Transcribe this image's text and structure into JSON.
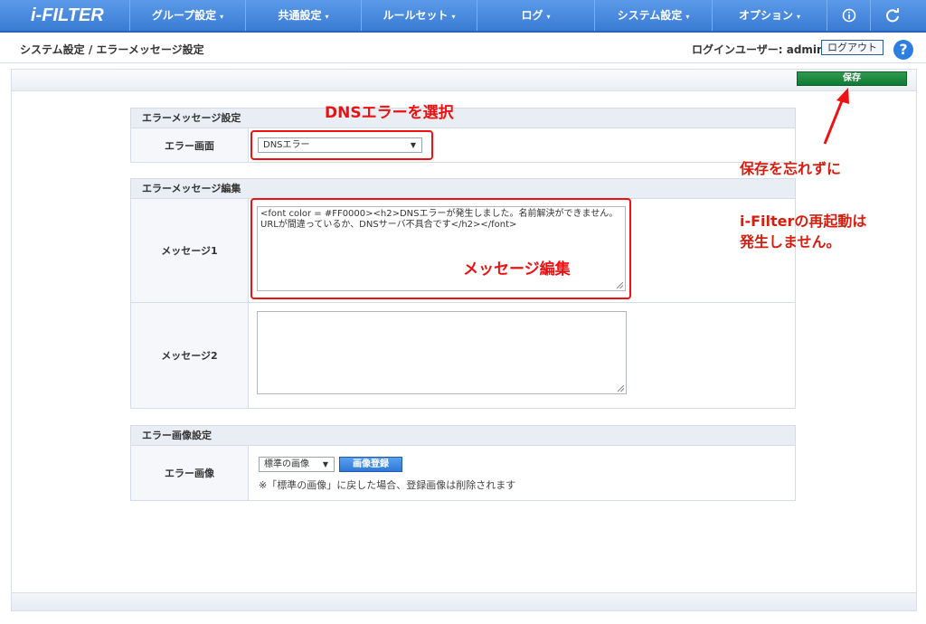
{
  "app": {
    "logo": "i-FILTER"
  },
  "nav": {
    "items": [
      {
        "label": "グループ設定",
        "caret": "▾"
      },
      {
        "label": "共通設定",
        "caret": "▾"
      },
      {
        "label": "ルールセット",
        "caret": "▾"
      },
      {
        "label": "ログ",
        "caret": "▾"
      },
      {
        "label": "システム設定",
        "caret": "▾"
      },
      {
        "label": "オプション",
        "caret": "▾"
      }
    ],
    "info_icon": "info-icon",
    "refresh_icon": "refresh-icon"
  },
  "header": {
    "breadcrumb": "システム設定 / エラーメッセージ設定",
    "login_user": "ログインユーザー: admin",
    "logout_label": "ログアウト",
    "help_label": "?"
  },
  "toolbar": {
    "save_label": "保存"
  },
  "sections": {
    "error_message_settings": {
      "title": "エラーメッセージ設定",
      "screen_label": "エラー画面",
      "screen_value": "DNSエラー"
    },
    "error_message_edit": {
      "title": "エラーメッセージ編集",
      "message1_label": "メッセージ1",
      "message1_value": "<font color = #FF0000><h2>DNSエラーが発生しました。名前解決ができません。URLが間違っているか、DNSサーバ不具合です</h2></font>",
      "message2_label": "メッセージ2",
      "message2_value": ""
    },
    "error_image_settings": {
      "title": "エラー画像設定",
      "image_label": "エラー画像",
      "image_select_value": "標準の画像",
      "register_button": "画像登録",
      "note": "※「標準の画像」に戻した場合、登録画像は削除されます"
    }
  },
  "annotations": {
    "select_dns": "DNSエラーを選択",
    "edit_message": "メッセージ編集",
    "save_reminder": "保存を忘れずに",
    "restart_line1": "i-Filterの再起動は",
    "restart_line2": "発生しません。"
  },
  "colors": {
    "nav": "#3a7bd5",
    "save": "#0f7a33",
    "annotation": "#e11111"
  }
}
